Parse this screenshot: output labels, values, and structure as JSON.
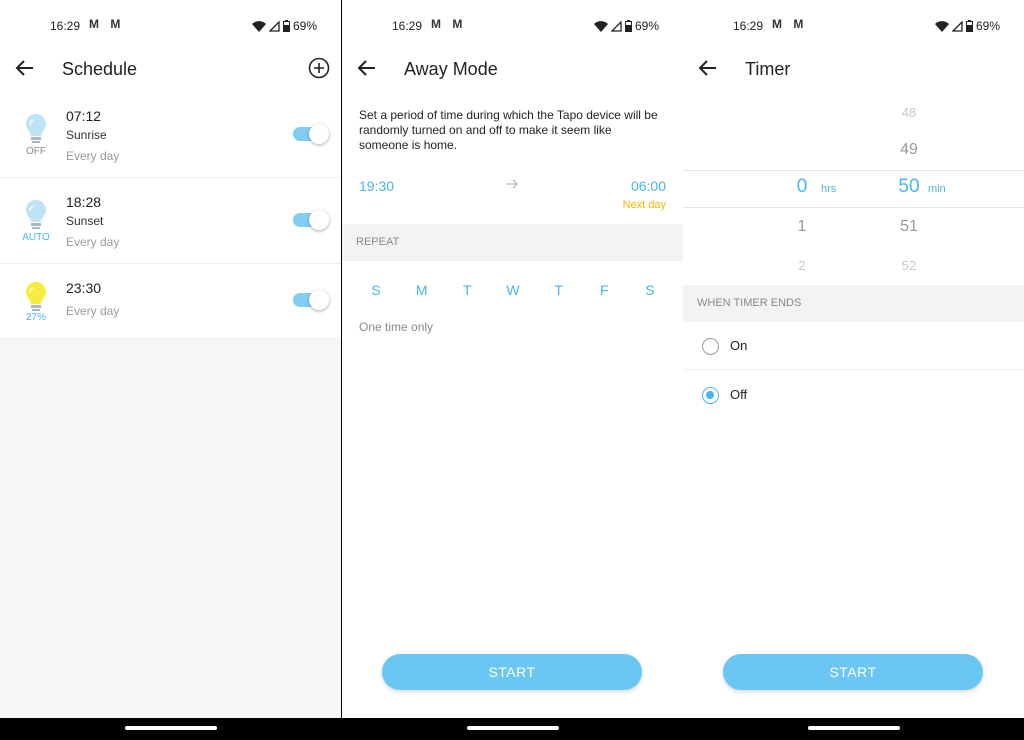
{
  "status": {
    "time": "16:29",
    "battery": "69%",
    "mail_icons": "M M"
  },
  "schedule": {
    "title": "Schedule",
    "items": [
      {
        "time": "07:12",
        "name": "Sunrise",
        "repeat": "Every day",
        "state": "OFF",
        "state_color": "#8a8a8a",
        "enabled": true
      },
      {
        "time": "18:28",
        "name": "Sunset",
        "repeat": "Every day",
        "state": "AUTO",
        "state_color": "#4bb5ea",
        "enabled": true
      },
      {
        "time": "23:30",
        "name": "",
        "repeat": "Every day",
        "state": "27%",
        "state_color": "#4bb5ea",
        "enabled": true
      }
    ]
  },
  "away": {
    "title": "Away Mode",
    "description": "Set a period of time during which the Tapo device will be randomly turned on and off to make it seem like someone is home.",
    "from": "19:30",
    "to": "06:00",
    "next_day": "Next day",
    "repeat_header": "REPEAT",
    "days": [
      "S",
      "M",
      "T",
      "W",
      "T",
      "F",
      "S"
    ],
    "one_time": "One time only",
    "start": "START"
  },
  "timer": {
    "title": "Timer",
    "hours": [
      "",
      "0",
      "1",
      "2"
    ],
    "minutes": [
      "48",
      "49",
      "50",
      "51",
      "52"
    ],
    "hrs_unit": "hrs",
    "min_unit": "min",
    "ends_header": "WHEN TIMER ENDS",
    "options": [
      {
        "label": "On",
        "checked": false
      },
      {
        "label": "Off",
        "checked": true
      }
    ],
    "start": "START"
  },
  "colors": {
    "accent": "#4bb5ea",
    "button": "#6cc6f4",
    "toggle": "#7fcff5",
    "warning": "#f4b400"
  }
}
